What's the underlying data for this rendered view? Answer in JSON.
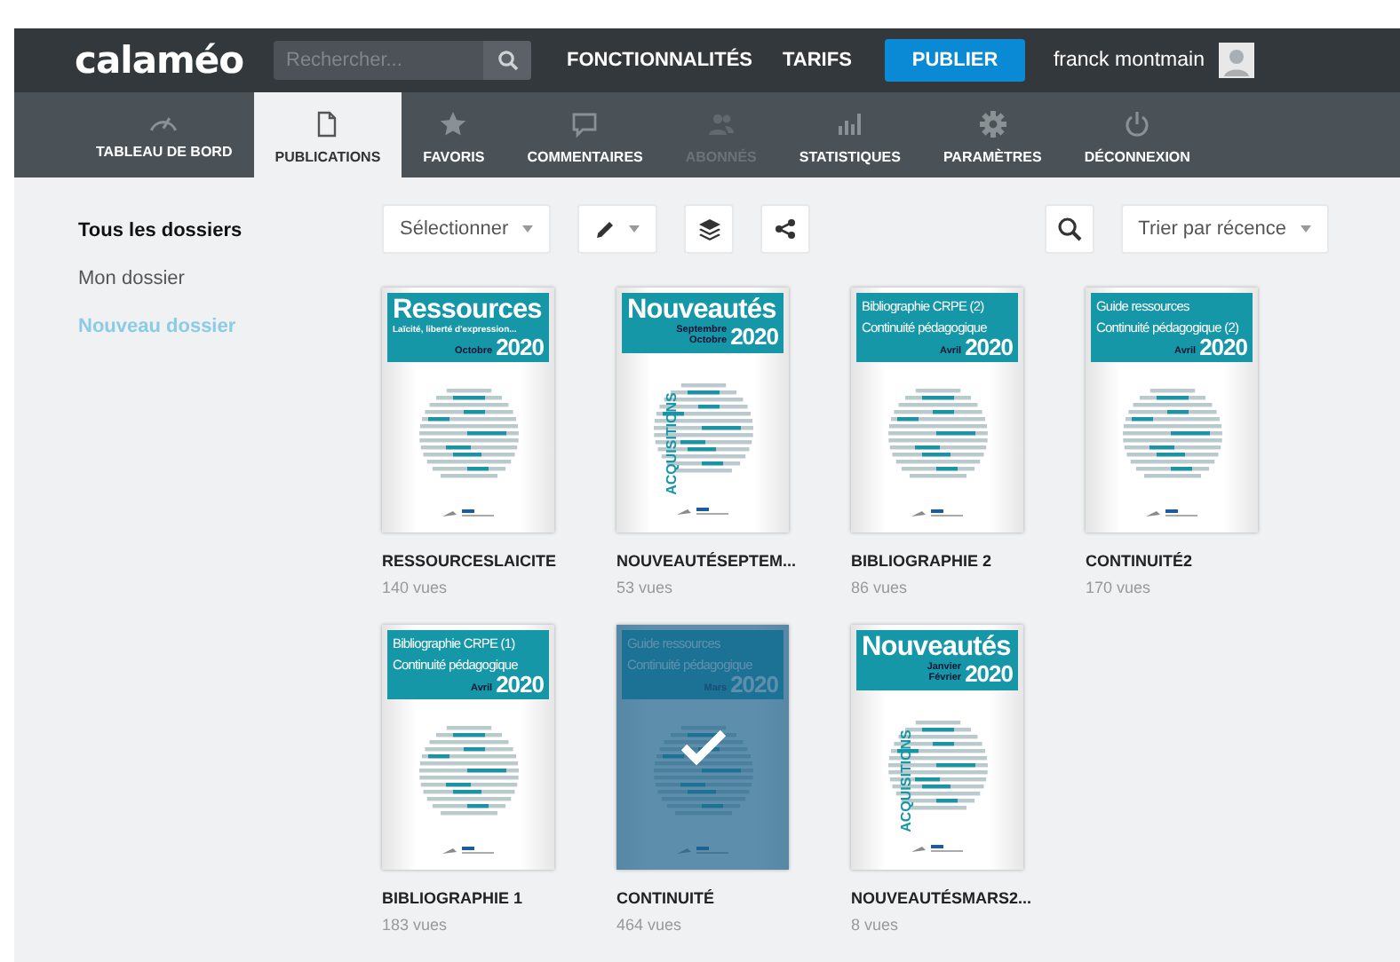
{
  "header": {
    "logo": "calaméo",
    "search": {
      "placeholder": "Rechercher..."
    },
    "links": [
      "FONCTIONNALITÉS",
      "TARIFS"
    ],
    "publish_button": "PUBLIER",
    "user_name": "franck montmain"
  },
  "nav": [
    {
      "label": "TABLEAU DE BORD",
      "selected": false,
      "disabled": false
    },
    {
      "label": "PUBLICATIONS",
      "selected": true,
      "disabled": false
    },
    {
      "label": "FAVORIS",
      "selected": false,
      "disabled": false
    },
    {
      "label": "COMMENTAIRES",
      "selected": false,
      "disabled": false
    },
    {
      "label": "ABONNÉS",
      "selected": false,
      "disabled": true
    },
    {
      "label": "STATISTIQUES",
      "selected": false,
      "disabled": false
    },
    {
      "label": "PARAMÈTRES",
      "selected": false,
      "disabled": false
    },
    {
      "label": "DÉCONNEXION",
      "selected": false,
      "disabled": false
    }
  ],
  "sidebar": {
    "items": [
      {
        "label": "Tous les dossiers",
        "selected": true,
        "kind": "folder"
      },
      {
        "label": "Mon dossier",
        "selected": false,
        "kind": "folder"
      },
      {
        "label": "Nouveau dossier",
        "selected": false,
        "kind": "action"
      }
    ]
  },
  "toolbar": {
    "select_dropdown": "Sélectionner",
    "sort_dropdown": "Trier par récence"
  },
  "publications": [
    {
      "name": "RESSOURCESLAICITE",
      "views": "140 vues",
      "selected": false,
      "cover": {
        "kind": "headline",
        "title": "Ressources",
        "subtitle": "Laïcité, liberté d'expression...",
        "month": "Octobre",
        "year": "2020"
      }
    },
    {
      "name": "NOUVEAUTÉSEPTEM...",
      "views": "53 vues",
      "selected": false,
      "cover": {
        "kind": "headline",
        "title": "Nouveautés",
        "month": "Septembre Octobre",
        "year": "2020",
        "side_label": "ACQUISITIONS"
      }
    },
    {
      "name": "BIBLIOGRAPHIE 2",
      "views": "86 vues",
      "selected": false,
      "cover": {
        "kind": "lines",
        "title": "Bibliographie CRPE (2)",
        "subtitle": "Continuité pédagogique",
        "month": "Avril",
        "year": "2020"
      }
    },
    {
      "name": "CONTINUITÉ2",
      "views": "170 vues",
      "selected": false,
      "cover": {
        "kind": "lines",
        "title": "Guide ressources",
        "subtitle": "Continuité pédagogique (2)",
        "month": "Avril",
        "year": "2020"
      }
    },
    {
      "name": "BIBLIOGRAPHIE 1",
      "views": "183 vues",
      "selected": false,
      "cover": {
        "kind": "lines",
        "title": "Bibliographie CRPE (1)",
        "subtitle": "Continuité pédagogique",
        "month": "Avril",
        "year": "2020"
      }
    },
    {
      "name": "CONTINUITÉ",
      "views": "464 vues",
      "selected": true,
      "cover": {
        "kind": "lines",
        "title": "Guide ressources",
        "subtitle": "Continuité pédagogique",
        "month": "Mars",
        "year": "2020"
      }
    },
    {
      "name": "NOUVEAUTÉSMARS2...",
      "views": "8 vues",
      "selected": false,
      "cover": {
        "kind": "headline",
        "title": "Nouveautés",
        "month": "Janvier Février",
        "year": "2020",
        "side_label": "ACQUISITIONS"
      }
    }
  ]
}
